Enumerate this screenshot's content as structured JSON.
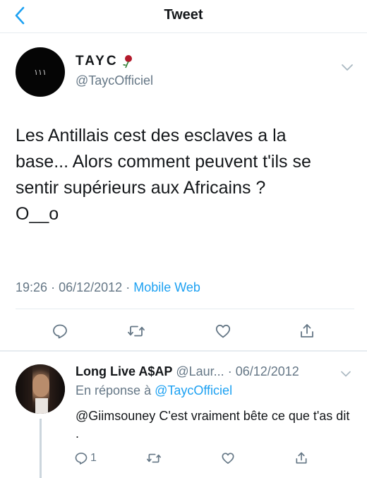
{
  "header": {
    "title": "Tweet",
    "back_icon": "chevron-left-icon"
  },
  "tweet": {
    "author_name": "TAYC",
    "author_handle": "@TaycOfficiel",
    "avatar_logo": "١١١",
    "text": "Les Antillais cest des esclaves a la\nbase... Alors comment peuvent t'ils se\nsentir supérieurs aux Africains ?\n O__o",
    "time": "19:26",
    "date": "06/12/2012",
    "source": "Mobile Web",
    "separator": "·",
    "actions": [
      "reply-icon",
      "retweet-icon",
      "like-icon",
      "share-icon"
    ]
  },
  "reply": {
    "author_name": "Long Live A$AP",
    "author_handle": "@Laur...",
    "date": "· 06/12/2012",
    "reply_to_prefix": "En réponse à",
    "reply_to_mention": "@TaycOfficiel",
    "text_mention": "@Giimsouney",
    "text_body": " C'est vraiment bête ce que t'as dit .",
    "reply_count": "1"
  },
  "colors": {
    "accent": "#1da1f2",
    "secondary_text": "#657786",
    "primary_text": "#14171a",
    "divider": "#e6ecf0"
  }
}
